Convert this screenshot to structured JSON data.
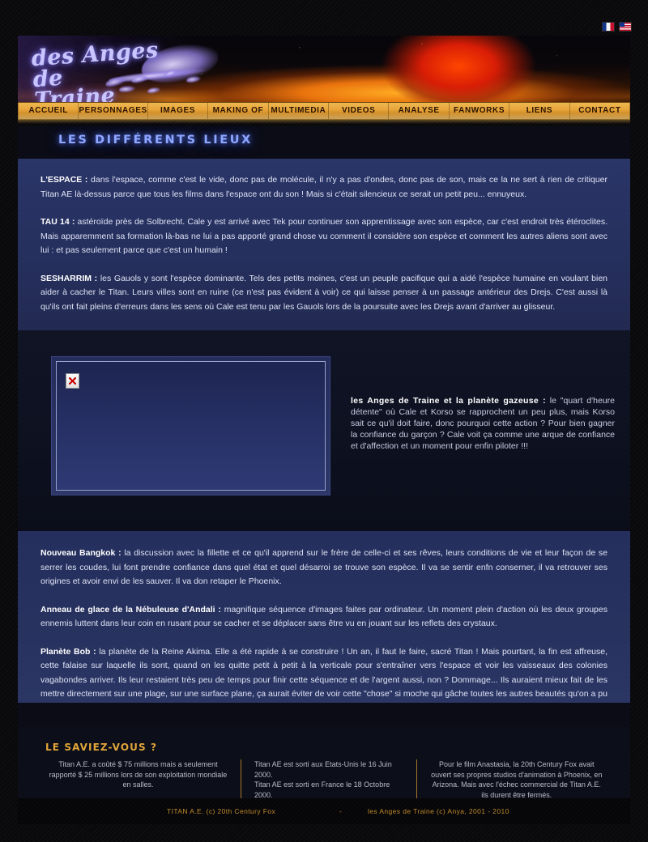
{
  "site": {
    "logo_text": "des Anges de\nTraine",
    "footer_left": "TITAN A.E. (c) 20th Century Fox",
    "footer_sep": "-",
    "footer_right": "les Anges de Traine (c) Anya, 2001 - 2010"
  },
  "languages": [
    {
      "name": "french-flag",
      "label": "Français"
    },
    {
      "name": "us-flag",
      "label": "English"
    }
  ],
  "nav": {
    "items": [
      "ACCUEIL",
      "PERSONNAGES",
      "IMAGES",
      "MAKING OF",
      "MULTIMEDIA",
      "VIDEOS",
      "ANALYSE",
      "FANWORKS",
      "LIENS",
      "CONTACT"
    ]
  },
  "page": {
    "title": "LES DIFFÉRENTS LIEUX"
  },
  "places_top": [
    {
      "name": "L'ESPACE :",
      "text": " dans l'espace, comme c'est le vide, donc pas de molécule, il n'y a pas d'ondes, donc pas de son, mais ce la ne sert à rien de critiquer Titan AE là-dessus parce que tous les films dans l'espace ont du son ! Mais si c'était silencieux ce serait un petit peu... ennuyeux."
    },
    {
      "name": "TAU 14 :",
      "text": " astéroïde près de Solbrecht. Cale y est arrivé avec Tek pour continuer son apprentissage avec son espèce, car c'est endroit très étéroclites. Mais apparemment sa formation là-bas ne lui a pas apporté grand chose vu comment il considère son espèce et comment les autres aliens sont avec lui : et pas seulement parce que c'est un humain !"
    },
    {
      "name": "SESHARRIM :",
      "text": " les Gauols y sont l'espèce dominante. Tels des petits moines, c'est un peuple pacifique qui a aidé l'espèce humaine en voulant bien aider à cacher le Titan. Leurs villes sont en ruine (ce n'est pas évident à voir) ce qui laisse penser à un passage antérieur des Drejs. C'est aussi là qu'ils ont fait pleins d'erreurs dans les sens où Cale est tenu par les Gauols lors de la poursuite avec les Drejs avant d'arriver au glisseur."
    }
  ],
  "screenshot": {
    "placeholder_icon": "broken-image-icon",
    "caption_title": "les Anges de Traine et la planète gazeuse :",
    "caption_text": " le \"quart d'heure détente\" où Cale et Korso se rapprochent un peu plus, mais Korso sait ce qu'il doit faire, donc pourquoi cette action ? Pour bien gagner la confiance du garçon ? Cale voit ça comme une arque de confiance et d'affection et un moment pour enfin piloter !!!"
  },
  "places_bottom": [
    {
      "name": "Nouveau Bangkok :",
      "text": " la discussion avec la fillette et ce qu'il apprend sur le frère de celle-ci et ses rêves, leurs conditions de vie et leur façon de se serrer les coudes, lui font prendre confiance dans quel état et quel désarroi se trouve son espèce. Il va se sentir enfn conserner, il va retrouver ses origines et avoir envi de les sauver. Il va don retaper le Phoenix."
    },
    {
      "name": "Anneau de glace de la Nébuleuse d'Andali :",
      "text": " magnifique séquence d'images faites par ordinateur. Un moment plein d'action où les deux groupes ennemis luttent dans leur coin en rusant pour se cacher et se déplacer sans être vu en jouant sur les reflets des crystaux."
    },
    {
      "name": "Planète Bob :",
      "text": " la planète de la Reine Akima. Elle a été rapide à se construire ! Un an, il faut le faire, sacré Titan ! Mais pourtant, la fin est affreuse, cette falaise sur laquelle ils sont, quand on les quitte petit à petit à la verticale pour s'entraîner vers l'espace et voir les vaisseaux des colonies vagabondes arriver. Ils leur restaient très peu de temps pour finir cette séquence et de l'argent aussi, non ? Dommage... Ils auraient mieux fait de les mettre directement sur une plage, sur une surface plane, ça aurait éviter de voir cette \"chose\" si moche qui gâche toutes les autres beautés qu'on a pu voir avant."
    }
  ],
  "did_you_know": {
    "title": "LE SAVIEZ-VOUS ?",
    "facts": [
      "Titan A.E. a coûté $ 75 millions mais a seulement rapporté $ 25 millions lors de son exploitation mondiale en salles.",
      "Titan AE est sorti aux Etats-Unis le 16 Juin 2000.\nTitan AE est sorti en France le 18 Octobre 2000.",
      "Pour le film Anastasia, la 20th Century Fox avait ouvert ses propres studios d'animation à Phoenix, en Arizona. Mais avec l'échec commercial de Titan A.E. ils durent être fermés."
    ]
  },
  "colors": {
    "nav_gold": "#e8a63b",
    "title_blue": "#8fa7ff",
    "accent_orange": "#e2a53a",
    "panel_blue": "#2a3568"
  }
}
